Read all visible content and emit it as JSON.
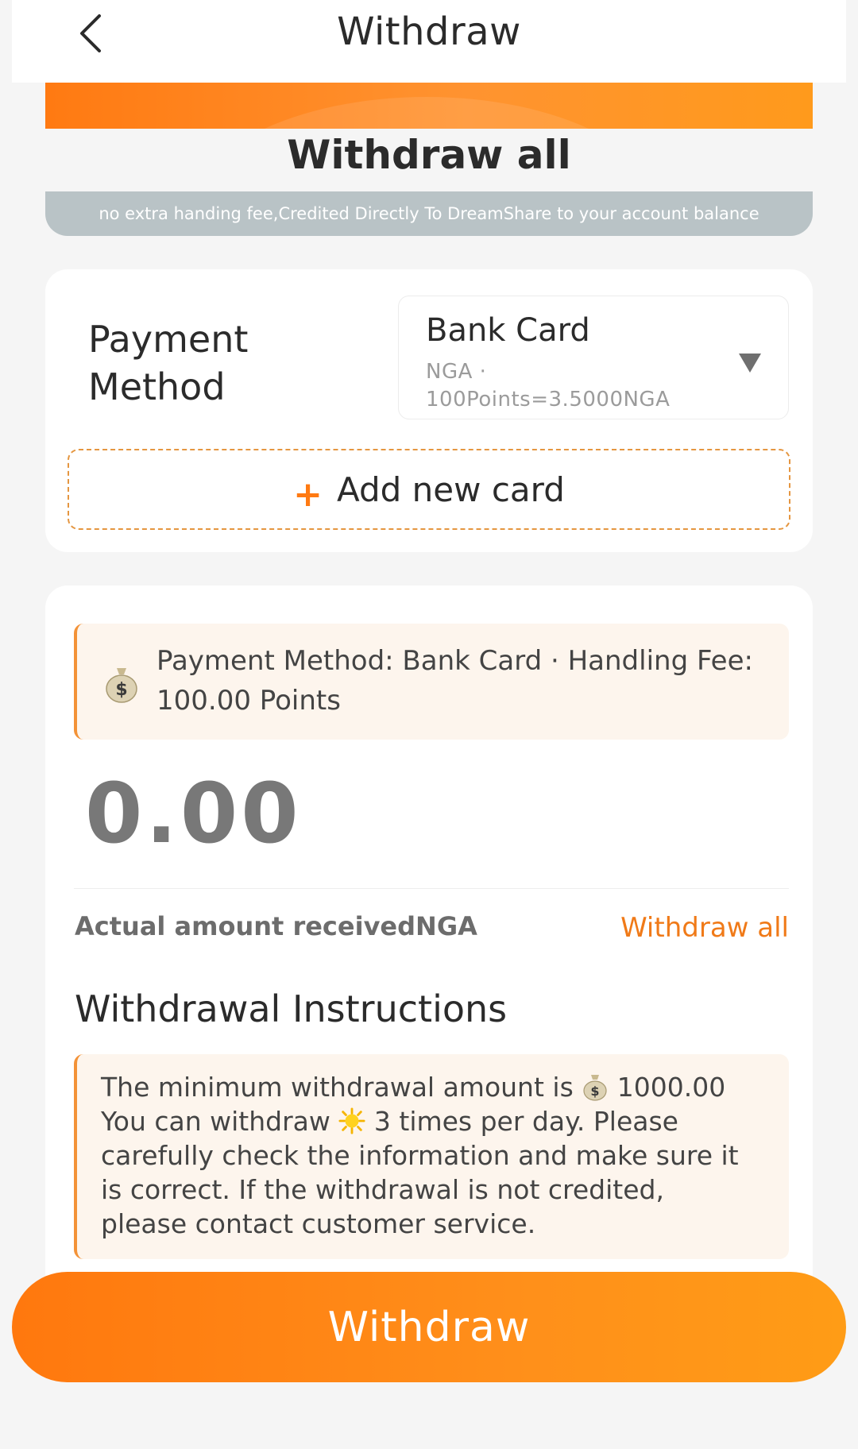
{
  "header": {
    "title": "Withdraw"
  },
  "banner": {
    "title": "Withdraw all",
    "notice": "no extra handing fee,Credited Directly To DreamShare to your account balance"
  },
  "payment": {
    "label": "Payment Method",
    "selected_method": "Bank Card",
    "currency_line": "NGA ·",
    "rate_line": "100Points=3.5000NGA",
    "add_card_label": "Add new card"
  },
  "fee_notice": {
    "text": "Payment Method: Bank Card · Handling Fee: 100.00 Points"
  },
  "amount": {
    "value": "0.00",
    "actual_label": "Actual amount receivedNGA",
    "withdraw_all_link": "Withdraw all"
  },
  "instructions": {
    "title": "Withdrawal Instructions",
    "part1": "The minimum withdrawal amount is",
    "part2": "1000.00 You can withdraw",
    "part3": "3 times per day. Please carefully check the information and make sure it is correct. If the withdrawal is not credited, please contact customer service."
  },
  "footer": {
    "withdraw_button": "Withdraw"
  },
  "icons": {
    "back": "chevron-left-icon",
    "dropdown": "triangle-down-icon",
    "add": "plus-icon",
    "money": "money-bag-icon",
    "sun": "sun-icon"
  },
  "colors": {
    "accent": "#ff8a16",
    "link": "#f07a18",
    "notice_bg": "#b9c3c6",
    "tip_bg": "#fdf5ed",
    "tip_border": "#f39237"
  }
}
